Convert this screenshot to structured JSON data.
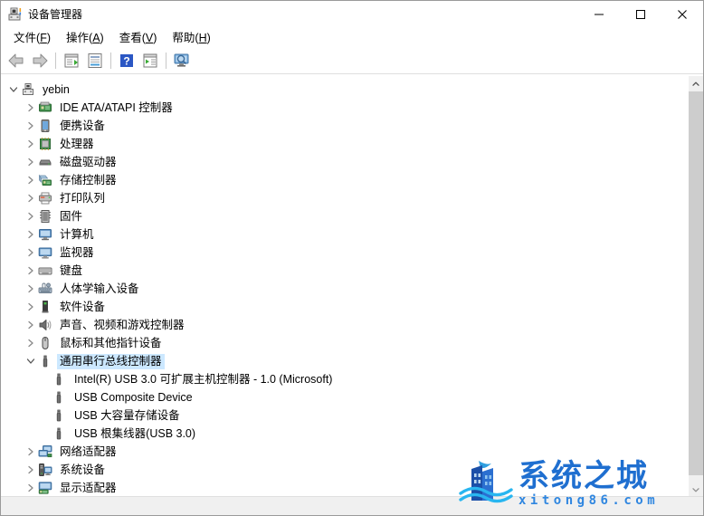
{
  "window": {
    "title": "设备管理器",
    "title_icon": "device-manager-icon",
    "minimize_label": "—",
    "maximize_label": "□",
    "close_label": "✕"
  },
  "menubar": {
    "items": [
      {
        "text": "文件",
        "accel": "F"
      },
      {
        "text": "操作",
        "accel": "A"
      },
      {
        "text": "查看",
        "accel": "V"
      },
      {
        "text": "帮助",
        "accel": "H"
      }
    ]
  },
  "toolbar": {
    "buttons": [
      {
        "name": "back-icon"
      },
      {
        "name": "forward-icon"
      },
      {
        "name": "separator"
      },
      {
        "name": "show-hidden-devices-icon"
      },
      {
        "name": "properties-icon"
      },
      {
        "name": "separator"
      },
      {
        "name": "help-icon"
      },
      {
        "name": "update-driver-icon"
      },
      {
        "name": "separator"
      },
      {
        "name": "scan-hardware-changes-icon"
      }
    ]
  },
  "tree": {
    "root": {
      "label": "yebin",
      "icon": "computer-node-icon",
      "expanded": true
    },
    "items": [
      {
        "label": "IDE ATA/ATAPI 控制器",
        "icon": "ide-controller-icon",
        "level": 1,
        "expanded": false,
        "selected": false
      },
      {
        "label": "便携设备",
        "icon": "portable-device-icon",
        "level": 1,
        "expanded": false,
        "selected": false
      },
      {
        "label": "处理器",
        "icon": "processor-icon",
        "level": 1,
        "expanded": false,
        "selected": false
      },
      {
        "label": "磁盘驱动器",
        "icon": "disk-drive-icon",
        "level": 1,
        "expanded": false,
        "selected": false
      },
      {
        "label": "存储控制器",
        "icon": "storage-controller-icon",
        "level": 1,
        "expanded": false,
        "selected": false
      },
      {
        "label": "打印队列",
        "icon": "printer-icon",
        "level": 1,
        "expanded": false,
        "selected": false
      },
      {
        "label": "固件",
        "icon": "firmware-icon",
        "level": 1,
        "expanded": false,
        "selected": false
      },
      {
        "label": "计算机",
        "icon": "computer-icon",
        "level": 1,
        "expanded": false,
        "selected": false
      },
      {
        "label": "监视器",
        "icon": "monitor-icon",
        "level": 1,
        "expanded": false,
        "selected": false
      },
      {
        "label": "键盘",
        "icon": "keyboard-icon",
        "level": 1,
        "expanded": false,
        "selected": false
      },
      {
        "label": "人体学输入设备",
        "icon": "hid-icon",
        "level": 1,
        "expanded": false,
        "selected": false
      },
      {
        "label": "软件设备",
        "icon": "software-device-icon",
        "level": 1,
        "expanded": false,
        "selected": false
      },
      {
        "label": "声音、视频和游戏控制器",
        "icon": "sound-icon",
        "level": 1,
        "expanded": false,
        "selected": false
      },
      {
        "label": "鼠标和其他指针设备",
        "icon": "mouse-icon",
        "level": 1,
        "expanded": false,
        "selected": false
      },
      {
        "label": "通用串行总线控制器",
        "icon": "usb-controller-icon",
        "level": 1,
        "expanded": true,
        "selected": true
      },
      {
        "label": "Intel(R) USB 3.0 可扩展主机控制器 - 1.0 (Microsoft)",
        "icon": "usb-device-icon",
        "level": 2,
        "expanded": null,
        "selected": false
      },
      {
        "label": "USB Composite Device",
        "icon": "usb-device-icon",
        "level": 2,
        "expanded": null,
        "selected": false
      },
      {
        "label": "USB 大容量存储设备",
        "icon": "usb-device-icon",
        "level": 2,
        "expanded": null,
        "selected": false
      },
      {
        "label": "USB 根集线器(USB 3.0)",
        "icon": "usb-device-icon",
        "level": 2,
        "expanded": null,
        "selected": false
      },
      {
        "label": "网络适配器",
        "icon": "network-adapter-icon",
        "level": 1,
        "expanded": false,
        "selected": false
      },
      {
        "label": "系统设备",
        "icon": "system-device-icon",
        "level": 1,
        "expanded": false,
        "selected": false
      },
      {
        "label": "显示适配器",
        "icon": "display-adapter-icon",
        "level": 1,
        "expanded": false,
        "selected": false
      }
    ]
  },
  "scrollbar": {
    "up_arrow": "chevron-up-icon",
    "down_arrow": "chevron-down-icon"
  },
  "statusbar": {
    "text": ""
  },
  "watermark": {
    "main_text": "系统之城",
    "sub_text": "xitong86.com",
    "color_main": "#1f6fd0",
    "color_sub": "#2f86e0"
  },
  "colors": {
    "selection": "#cce8ff",
    "window_bg": "#ffffff",
    "chrome_bg": "#f0f0f0"
  }
}
